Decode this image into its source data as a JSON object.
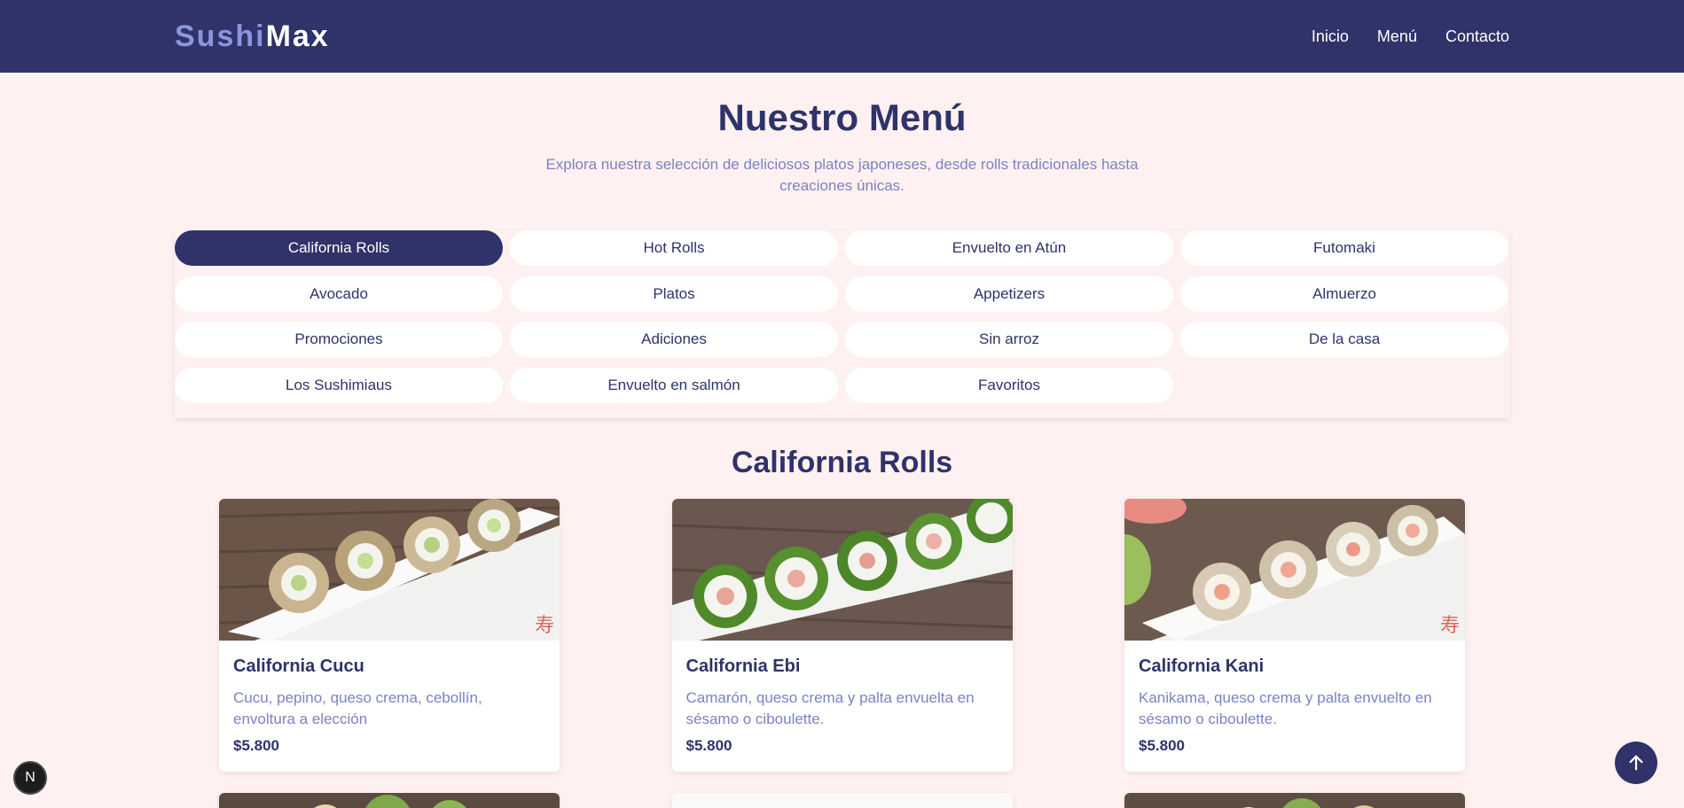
{
  "brand": {
    "part1": "Sushi",
    "part2": "Max"
  },
  "nav": {
    "items": [
      "Inicio",
      "Menú",
      "Contacto"
    ]
  },
  "hero": {
    "title": "Nuestro Menú",
    "subtitle": "Explora nuestra selección de deliciosos platos japoneses, desde rolls tradicionales hasta creaciones únicas."
  },
  "categories": {
    "active": "California Rolls",
    "items": [
      "California Rolls",
      "Hot Rolls",
      "Envuelto en Atún",
      "Futomaki",
      "Avocado",
      "Platos",
      "Appetizers",
      "Almuerzo",
      "Promociones",
      "Adiciones",
      "Sin arroz",
      "De la casa",
      "Los Sushimiaus",
      "Envuelto en salmón",
      "Favoritos"
    ]
  },
  "section": {
    "title": "California Rolls"
  },
  "products": [
    {
      "name": "California Cucu",
      "description": "Cucu, pepino, queso crema, cebollín, envoltura a elección",
      "price": "$5.800"
    },
    {
      "name": "California Ebi",
      "description": "Camarón, queso crema y palta envuelta en sésamo o ciboulette.",
      "price": "$5.800"
    },
    {
      "name": "California Kani",
      "description": "Kanikama, queso crema y palta envuelto en sésamo o ciboulette.",
      "price": "$5.800"
    }
  ],
  "icons": {
    "scroll_top": "arrow-up-icon",
    "dev_badge": "nextjs-icon"
  },
  "devBadge": {
    "letter": "N"
  },
  "colors": {
    "navy": "#2f3369",
    "background": "#fff1f1",
    "accent": "#7b82c4",
    "logo_light": "#8b95de"
  }
}
